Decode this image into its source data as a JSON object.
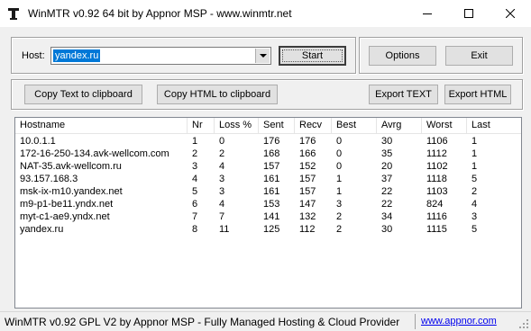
{
  "window": {
    "title": "WinMTR v0.92 64 bit by Appnor MSP - www.winmtr.net",
    "icon": "winmtr-app-icon",
    "controls": [
      "minimize-icon",
      "maximize-icon",
      "close-icon"
    ]
  },
  "host": {
    "label": "Host:",
    "value": "yandex.ru",
    "start_label": "Start"
  },
  "right_buttons": {
    "options_label": "Options",
    "exit_label": "Exit"
  },
  "export": {
    "copy_text": "Copy Text to clipboard",
    "copy_html": "Copy HTML to clipboard",
    "export_text": "Export TEXT",
    "export_html": "Export HTML"
  },
  "table": {
    "columns": [
      "Hostname",
      "Nr",
      "Loss %",
      "Sent",
      "Recv",
      "Best",
      "Avrg",
      "Worst",
      "Last"
    ],
    "rows": [
      [
        "10.0.1.1",
        "1",
        "0",
        "176",
        "176",
        "0",
        "30",
        "1106",
        "1"
      ],
      [
        "172-16-250-134.avk-wellcom.com",
        "2",
        "2",
        "168",
        "166",
        "0",
        "35",
        "1112",
        "1"
      ],
      [
        "NAT-35.avk-wellcom.ru",
        "3",
        "4",
        "157",
        "152",
        "0",
        "20",
        "1102",
        "1"
      ],
      [
        "93.157.168.3",
        "4",
        "3",
        "161",
        "157",
        "1",
        "37",
        "1118",
        "5"
      ],
      [
        "msk-ix-m10.yandex.net",
        "5",
        "3",
        "161",
        "157",
        "1",
        "22",
        "1103",
        "2"
      ],
      [
        "m9-p1-be11.yndx.net",
        "6",
        "4",
        "153",
        "147",
        "3",
        "22",
        "824",
        "4"
      ],
      [
        "myt-c1-ae9.yndx.net",
        "7",
        "7",
        "141",
        "132",
        "2",
        "34",
        "1116",
        "3"
      ],
      [
        "yandex.ru",
        "8",
        "11",
        "125",
        "112",
        "2",
        "30",
        "1115",
        "5"
      ]
    ]
  },
  "status": {
    "text": "WinMTR v0.92 GPL V2 by Appnor MSP - Fully Managed Hosting & Cloud Provider",
    "link": "www.appnor.com"
  }
}
